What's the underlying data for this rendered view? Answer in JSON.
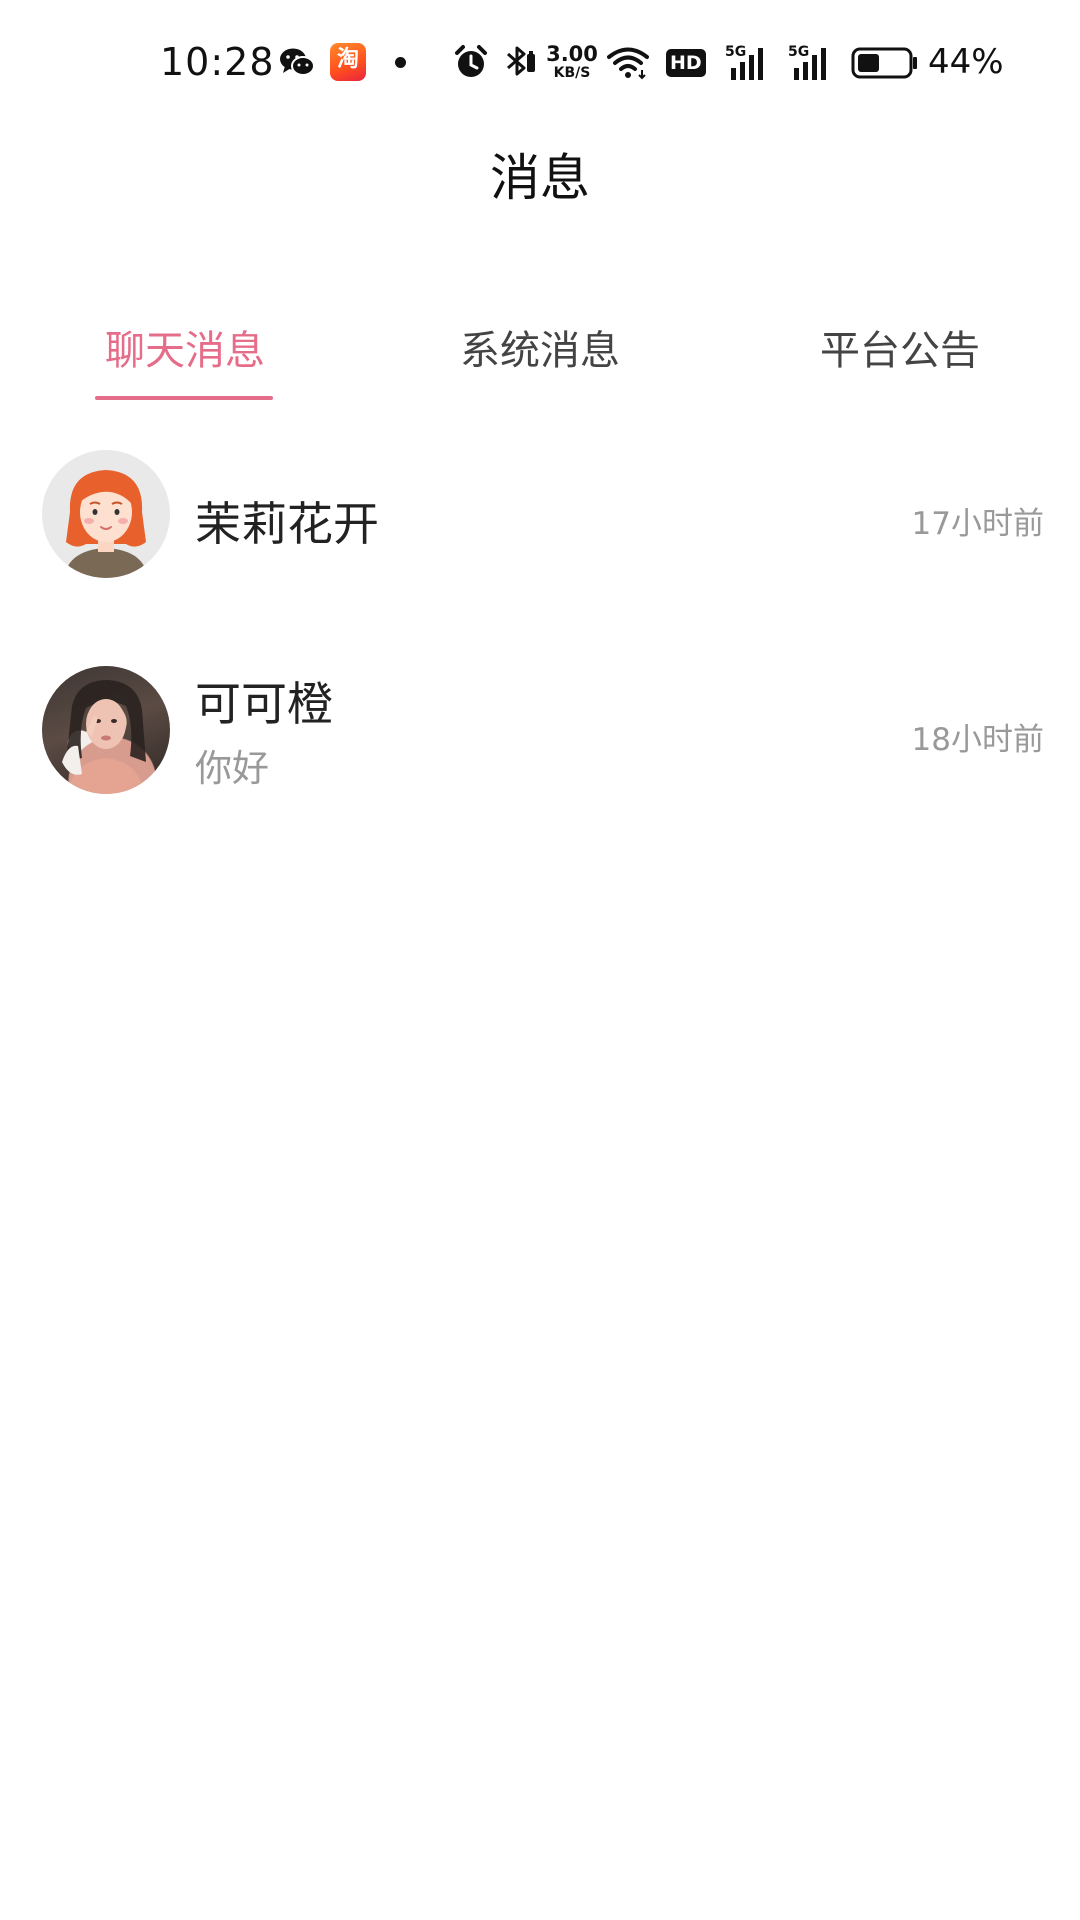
{
  "status_bar": {
    "time": "10:28",
    "taobao_glyph": "淘",
    "net_speed_value": "3.00",
    "net_speed_unit": "KB/S",
    "hd_label": "HD",
    "battery_percent_text": "44%",
    "battery_level": 0.44,
    "icons": [
      "wechat-icon",
      "taobao-icon",
      "notification-dot-icon",
      "alarm-icon",
      "bluetooth-icon",
      "wifi-icon",
      "hd-voice-icon",
      "signal-5g-icon",
      "signal-5g-icon",
      "battery-icon"
    ]
  },
  "header": {
    "title": "消息"
  },
  "tabs": [
    {
      "label": "聊天消息",
      "active": true
    },
    {
      "label": "系统消息",
      "active": false
    },
    {
      "label": "平台公告",
      "active": false
    }
  ],
  "chats": [
    {
      "name": "茉莉花开",
      "preview": "",
      "time": "17小时前",
      "avatar": "cartoon-girl-avatar"
    },
    {
      "name": "可可橙",
      "preview": "你好",
      "time": "18小时前",
      "avatar": "photo-avatar"
    }
  ],
  "colors": {
    "accent": "#e66d8a",
    "text_primary": "#222222",
    "text_secondary": "#999999",
    "background": "#ffffff"
  }
}
